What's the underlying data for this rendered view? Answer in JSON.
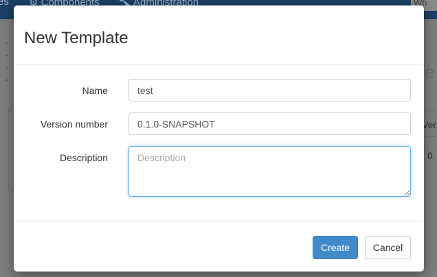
{
  "background": {
    "nav_partial": "es",
    "nav_components": "Components",
    "nav_administration": "Administration",
    "nav_user": "Wh",
    "right_heading": "e",
    "right_col_header": "Vers",
    "right_col_value": "0."
  },
  "modal": {
    "title": "New Template",
    "fields": {
      "name": {
        "label": "Name",
        "value": "test"
      },
      "version": {
        "label": "Version number",
        "value": "0.1.0-SNAPSHOT"
      },
      "description": {
        "label": "Description",
        "value": "",
        "placeholder": "Description"
      }
    },
    "buttons": {
      "create": "Create",
      "cancel": "Cancel"
    }
  },
  "colors": {
    "primary": "#428bca",
    "navbar": "#1b3f66",
    "focus": "#66afe9"
  }
}
